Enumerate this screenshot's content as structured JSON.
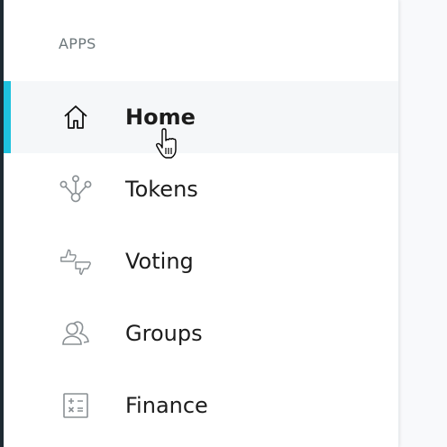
{
  "sidebar": {
    "section_title": "APPS",
    "items": [
      {
        "label": "Home",
        "icon": "home-icon",
        "active": true
      },
      {
        "label": "Tokens",
        "icon": "tokens-icon"
      },
      {
        "label": "Voting",
        "icon": "voting-icon"
      },
      {
        "label": "Groups",
        "icon": "groups-icon"
      },
      {
        "label": "Finance",
        "icon": "finance-icon"
      }
    ]
  },
  "colors": {
    "accent": "#1ec2de",
    "dark_strip": "#1d2a32",
    "icon_gray": "#8a9094"
  }
}
